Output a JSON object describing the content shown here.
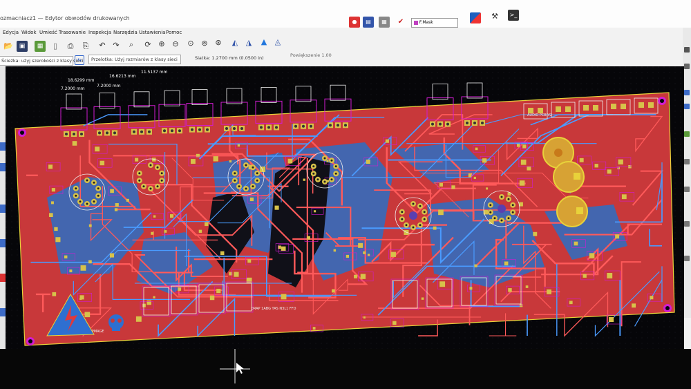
{
  "window": {
    "title": "ozmacniacz1 — Edytor obwodów drukowanych"
  },
  "menu": [
    {
      "label": "Edycja"
    },
    {
      "label": "Widok"
    },
    {
      "label": "Umieść"
    },
    {
      "label": "Trasowanie"
    },
    {
      "label": "Inspekcja"
    },
    {
      "label": "Narzędzia"
    },
    {
      "label": "Ustawienia"
    },
    {
      "label": "Pomoc"
    }
  ],
  "toolbar2": {
    "track_width": "Ścieżka: użyj szerokości z klasy sieci",
    "via_size": "Przelotka: Użyj rozmiarów z klasy sieci",
    "grid": "Siatka: 1.2700 mm (0.0500 in)",
    "zoom": "Powiększenie 1.00"
  },
  "layer_selector": {
    "label": "F.Mask",
    "color": "#c040c0"
  },
  "dimensions": [
    "18.6299 mm",
    "16.6213 mm",
    "11.5137 mm",
    "7.2000 mm",
    "7.2000 mm"
  ],
  "board_labels": [
    "DRAP 1ABG TAS N3L1 FFD",
    "AUDIO PCB V2",
    "BIOLSPMAGE"
  ],
  "colors": {
    "canvas_bg": "#060609",
    "front_copper": "#e0393b",
    "back_copper": "#2f7fd8",
    "pads": "#d7c24a",
    "courtyard": "#d21cd2",
    "edge_cuts": "#e8d23a",
    "silkscreen": "#f0f0f0"
  },
  "icons": [
    "save-icon",
    "open-icon",
    "undo-icon",
    "redo-icon",
    "print-icon",
    "zoom-in-icon",
    "zoom-out-icon",
    "zoom-fit-icon",
    "refresh-icon",
    "drc-icon",
    "3d-view-icon",
    "warning-icon",
    "skull-icon"
  ]
}
